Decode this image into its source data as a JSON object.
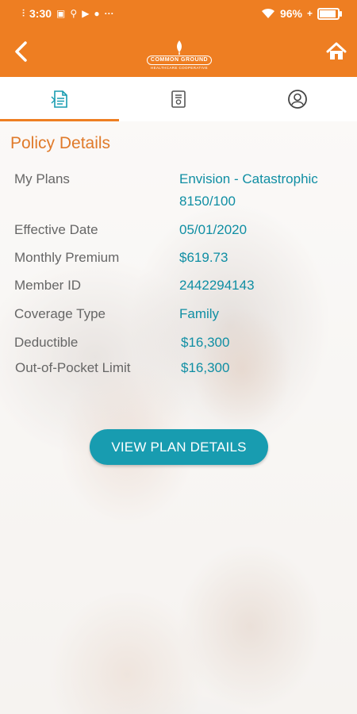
{
  "status": {
    "time": "3:30",
    "battery": "96%",
    "icons": [
      "signal-alt-icon",
      "notification-icon",
      "usb-icon",
      "youtube-icon",
      "chat-icon",
      "more-icon",
      "wifi-icon",
      "battery-icon"
    ]
  },
  "header": {
    "logo_top": "COMMON GROUND",
    "logo_sub": "HEALTHCARE COOPERATIVE",
    "icons": [
      "back-icon",
      "home-icon"
    ]
  },
  "tabs": [
    {
      "name": "policy",
      "icon": "document-icon",
      "active": true
    },
    {
      "name": "id-card",
      "icon": "id-card-icon",
      "active": false
    },
    {
      "name": "profile",
      "icon": "profile-icon",
      "active": false
    }
  ],
  "policy": {
    "title": "Policy Details",
    "rows": [
      {
        "label": "My Plans",
        "value": "Envision - Catastrophic 8150/100"
      },
      {
        "label": "Effective Date",
        "value": "05/01/2020"
      },
      {
        "label": "Monthly Premium",
        "value": "$619.73"
      },
      {
        "label": "Member ID",
        "value": "2442294143"
      },
      {
        "label": "Coverage Type",
        "value": "Family"
      },
      {
        "label": "Deductible",
        "value": "$16,300"
      },
      {
        "label": "Out-of-Pocket Limit",
        "value": "$16,300"
      }
    ]
  },
  "cta": {
    "label": "VIEW PLAN DETAILS"
  },
  "colors": {
    "brand": "#ee7e22",
    "accent": "#189cb0",
    "value_text": "#0f8ea3"
  }
}
